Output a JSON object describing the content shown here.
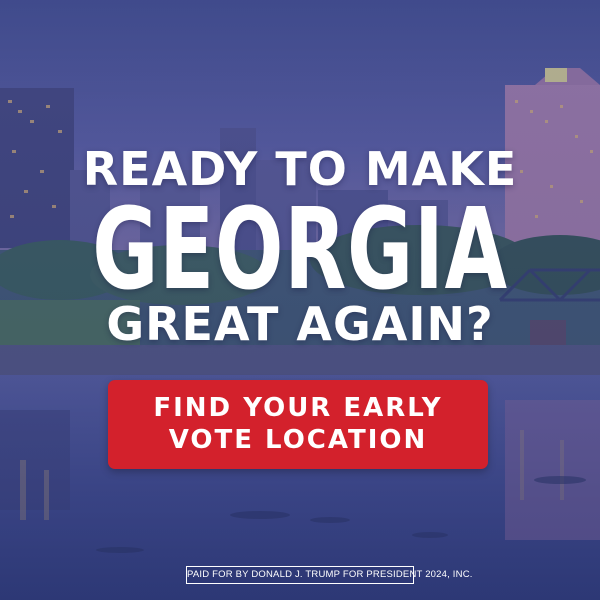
{
  "headline": {
    "line1": "READY TO MAKE",
    "line2": "GEORGIA",
    "line3": "GREAT AGAIN?"
  },
  "cta": {
    "line1": "FIND YOUR EARLY",
    "line2": "VOTE LOCATION",
    "color": "#d3212c"
  },
  "disclaimer": "PAID FOR BY DONALD J. TRUMP FOR PRESIDENT 2024, INC.",
  "colors": {
    "overlay": "#4a4f9a",
    "text": "#ffffff"
  }
}
